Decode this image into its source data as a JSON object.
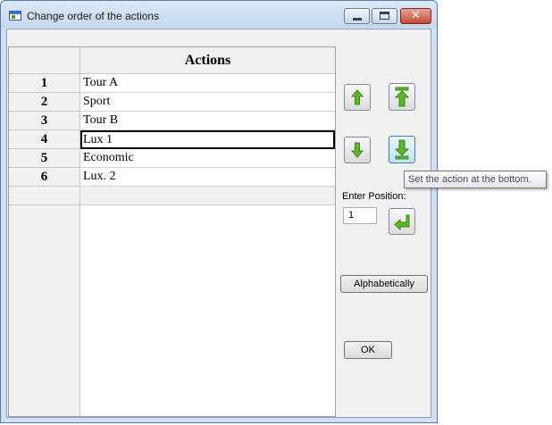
{
  "window": {
    "title": "Change order of the actions",
    "close_glyph": "✕"
  },
  "table": {
    "column_header": "Actions",
    "rows": [
      {
        "number": "1",
        "action": "Tour A"
      },
      {
        "number": "2",
        "action": "Sport"
      },
      {
        "number": "3",
        "action": "Tour B"
      },
      {
        "number": "4",
        "action": "Lux 1"
      },
      {
        "number": "5",
        "action": "Economic"
      },
      {
        "number": "6",
        "action": "Lux. 2"
      }
    ]
  },
  "controls": {
    "move_up_icon": "arrow-up-icon",
    "move_top_icon": "arrow-to-top-icon",
    "move_down_icon": "arrow-down-icon",
    "move_bottom_icon": "arrow-to-bottom-icon",
    "enter_position_label": "Enter Position:",
    "position_value": "1",
    "apply_position_icon": "enter-return-icon",
    "alphabetically_label": "Alphabetically",
    "ok_label": "OK",
    "tooltip_text": "Set the action at the bottom."
  },
  "colors": {
    "arrow_green": "#5bb52a",
    "arrow_green_dark": "#3d8a17",
    "hover_blue": "#bfe3f7"
  }
}
